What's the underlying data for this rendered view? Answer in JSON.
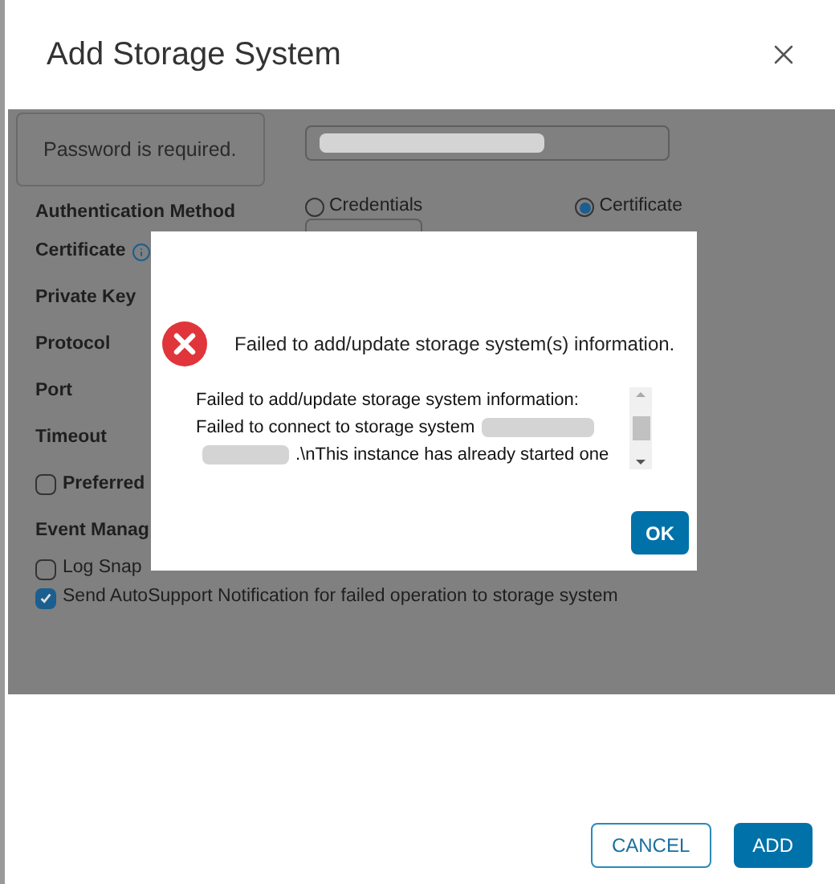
{
  "dialog": {
    "title": "Add Storage System"
  },
  "form": {
    "tooltip": "Password is required.",
    "auth_label": "Authentication Method",
    "auth_options": [
      {
        "label": "Credentials",
        "selected": false
      },
      {
        "label": "Certificate",
        "selected": true
      }
    ],
    "labels": [
      {
        "text": "Certificate",
        "kind": "info"
      },
      {
        "text": "Private Key",
        "kind": "plain"
      },
      {
        "text": "Protocol",
        "kind": "plain"
      },
      {
        "text": "Port",
        "kind": "plain"
      },
      {
        "text": "Timeout",
        "kind": "plain"
      }
    ],
    "preferred": {
      "label": "Preferred",
      "checked": false
    },
    "section": "Event Manag",
    "checkboxes": [
      {
        "label": "Log Snap",
        "checked": false
      },
      {
        "label": "Send AutoSupport Notification for failed operation to storage system",
        "checked": true
      }
    ]
  },
  "alert": {
    "heading": "Failed to add/update storage system(s) information.",
    "lines": [
      {
        "text": "Failed to add/update storage system information:",
        "blur_before": false,
        "blur_after": false
      },
      {
        "text": "Failed to connect to storage system",
        "blur_before": false,
        "blur_after": true
      },
      {
        "text": ".\\nThis instance has already started one",
        "blur_before": true,
        "blur_after": false
      }
    ],
    "ok": "OK"
  },
  "buttons": [
    {
      "label": "CANCEL",
      "kind": "secondary"
    },
    {
      "label": "ADD",
      "kind": "primary"
    }
  ]
}
